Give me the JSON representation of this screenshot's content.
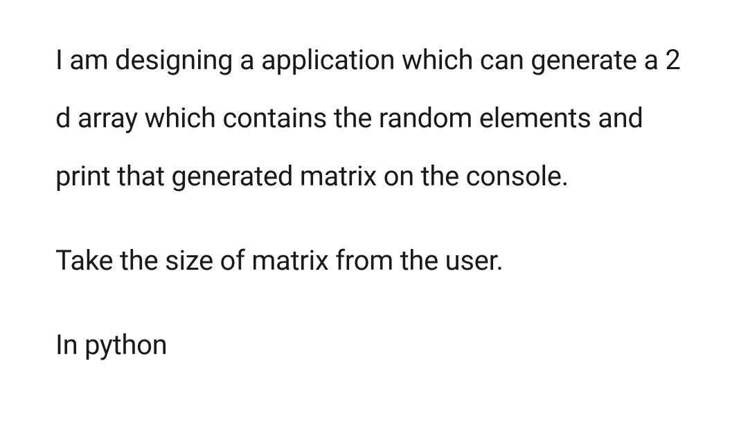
{
  "document": {
    "paragraphs": [
      "I am designing a application which can generate a 2 d array which contains the random elements and print that generated matrix on the console.",
      "Take the size of matrix from the user.",
      "In python"
    ]
  }
}
